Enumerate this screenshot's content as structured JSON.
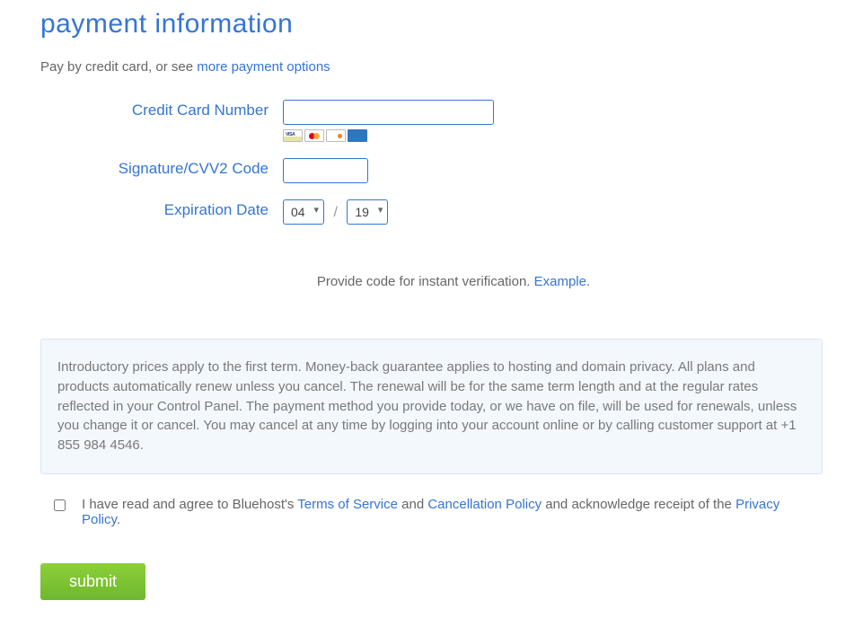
{
  "title": "payment information",
  "intro_prefix": "Pay by credit card, or see ",
  "intro_link": "more payment options",
  "labels": {
    "cc": "Credit Card Number",
    "cvv": "Signature/CVV2 Code",
    "exp": "Expiration Date"
  },
  "exp_month": "04",
  "exp_year": "19",
  "verification_prefix": "Provide code for instant verification. ",
  "verification_link": "Example",
  "verification_suffix": ".",
  "disclaimer": "Introductory prices apply to the first term. Money-back guarantee applies to hosting and domain privacy. All plans and products automatically renew unless you cancel. The renewal will be for the same term length and at the regular rates reflected in your Control Panel. The payment method you provide today, or we have on file, will be used for renewals, unless you change it or cancel. You may cancel at any time by logging into your account online or by calling customer support at +1 855 984 4546.",
  "agree_prefix": "I have read and agree to Bluehost's ",
  "agree_tos": "Terms of Service",
  "agree_and": " and ",
  "agree_cancel": "Cancellation Policy",
  "agree_ack": " and acknowledge receipt of the ",
  "agree_privacy": "Privacy Policy",
  "agree_suffix": ".",
  "submit": "submit"
}
